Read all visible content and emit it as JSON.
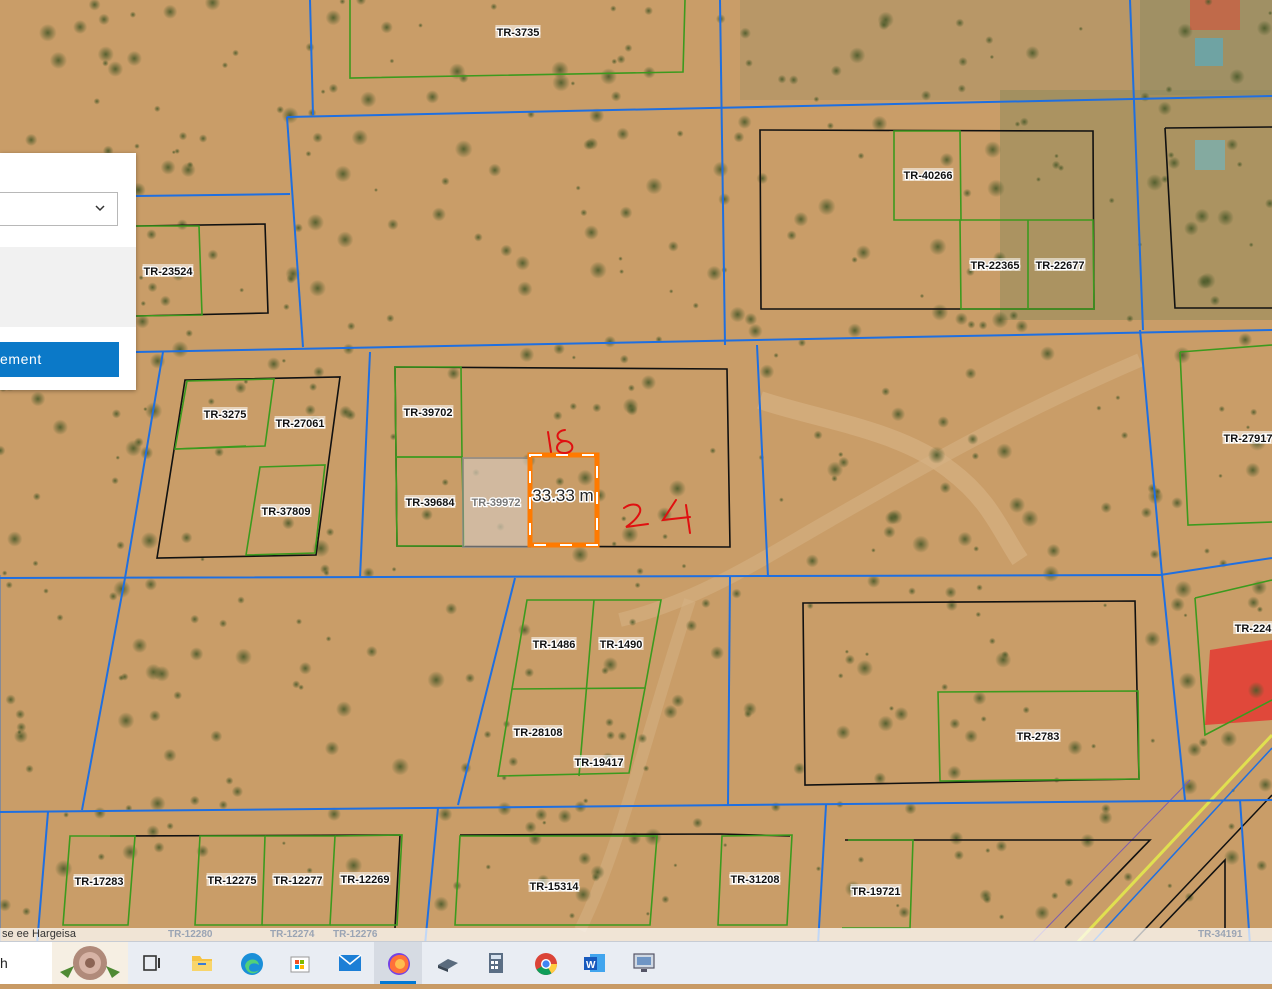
{
  "map": {
    "parcels": [
      "TR-3735",
      "TR-40266",
      "TR-22365",
      "TR-22677",
      "TR-23524",
      "TR-3275",
      "TR-27061",
      "TR-37809",
      "TR-39702",
      "TR-39684",
      "TR-39972",
      "TR-27917",
      "TR-1486",
      "TR-1490",
      "TR-28108",
      "TR-19417",
      "TR-2783",
      "TR-224",
      "TR-17283",
      "TR-12275",
      "TR-12277",
      "TR-12269",
      "TR-15314",
      "TR-31208",
      "TR-19721"
    ],
    "measurement": "33.33 m",
    "annotations": [
      "18",
      "24"
    ],
    "colors": {
      "road_lines": "#1f6fe0",
      "parcel_green": "#3c9a1e",
      "parcel_black": "#111111",
      "measure_orange": "#ff7a00",
      "annotation_red": "#e01010"
    }
  },
  "panel": {
    "button_label": "ement"
  },
  "attribution": {
    "text": "se ee Hargeisa",
    "faded_labels": [
      "TR-12280",
      "TR-12274",
      "TR-12276",
      "TR-34191"
    ]
  },
  "taskbar": {
    "search_fragment": "h",
    "apps": [
      "task-view",
      "file-explorer",
      "edge",
      "store",
      "mail",
      "firefox",
      "shell",
      "calculator",
      "chrome",
      "word",
      "remote-desktop"
    ]
  }
}
